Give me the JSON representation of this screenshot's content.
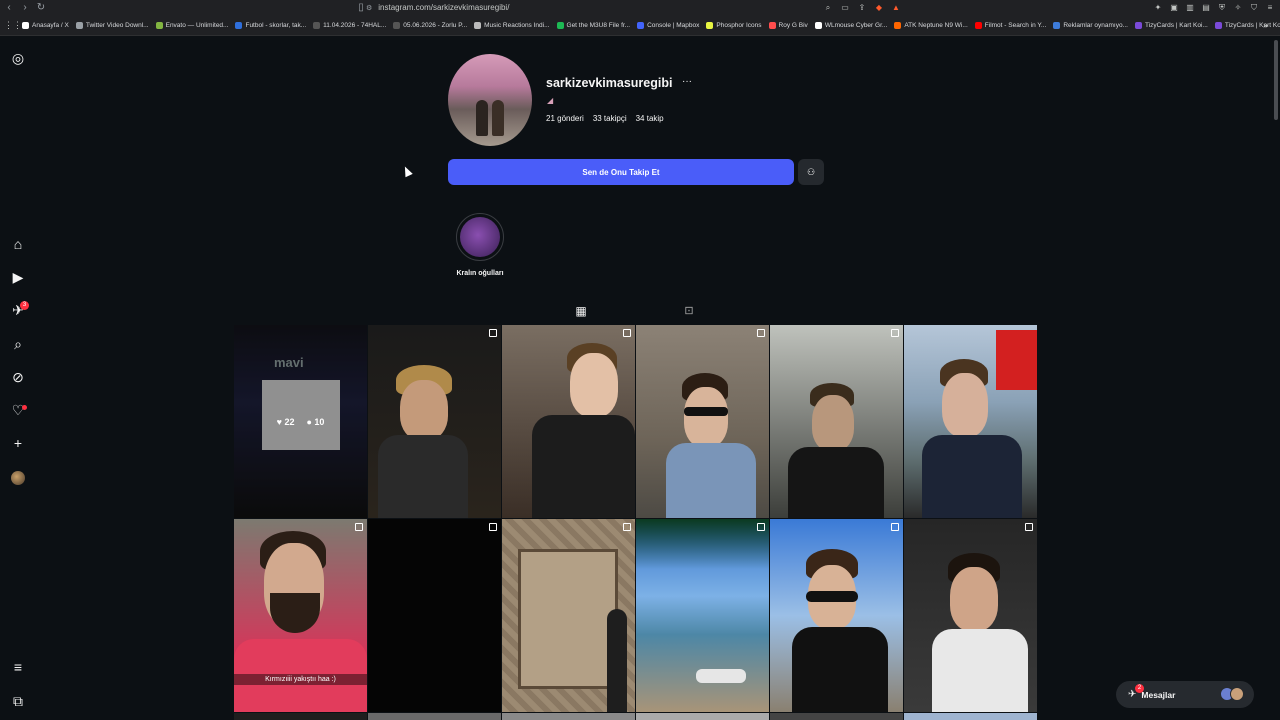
{
  "browser": {
    "url": "instagram.com/sarkizevkimasuregibi/",
    "bookmarks": [
      {
        "label": "Anasayfa / X",
        "color": "#ffffff"
      },
      {
        "label": "Twitter Video Downl...",
        "color": "#9aa0a6"
      },
      {
        "label": "Envato — Unlimited...",
        "color": "#82b541"
      },
      {
        "label": "Futbol - skorlar, tak...",
        "color": "#2f6fdc"
      },
      {
        "label": "11.04.2026 - 74HAL...",
        "color": "#555555"
      },
      {
        "label": "05.06.2026 - Zorlu P...",
        "color": "#555555"
      },
      {
        "label": "Music Reactions Indi...",
        "color": "#bbbbbb"
      },
      {
        "label": "Get the M3U8 File fr...",
        "color": "#1db954"
      },
      {
        "label": "Console | Mapbox",
        "color": "#4264fb"
      },
      {
        "label": "Phosphor Icons",
        "color": "#e8f542"
      },
      {
        "label": "Roy G Biv",
        "color": "#ff4d4d"
      },
      {
        "label": "WLmouse Cyber Gr...",
        "color": "#ffffff"
      },
      {
        "label": "ATK Neptune N9 Wi...",
        "color": "#ff6600"
      },
      {
        "label": "Filmot - Search in Y...",
        "color": "#ff0000"
      },
      {
        "label": "Reklamlar oynamıyo...",
        "color": "#3d7bd9"
      },
      {
        "label": "TizyCards | Kart Koi...",
        "color": "#7a4ad9"
      },
      {
        "label": "TizyCards | Kart Koi...",
        "color": "#7a4ad9"
      }
    ]
  },
  "sidebar": {
    "notifications_badge": "3"
  },
  "profile": {
    "username": "sarkizevkimasuregibi",
    "stats": {
      "posts": "21 gönderi",
      "followers": "33 takipçi",
      "following": "34 takip"
    },
    "follow_button": "Sen de Onu Takip Et",
    "highlight_label": "Kralın oğulları"
  },
  "posts": [
    {
      "likes": "22",
      "comments": "10"
    },
    {},
    {},
    {},
    {},
    {},
    {
      "caption": "Kırmızıiii yakıştıı haa :)"
    }
  ],
  "messages": {
    "label": "Mesajlar",
    "badge": "2"
  },
  "colors": {
    "accent": "#4a5df9",
    "background": "#0c1014",
    "badge": "#ff3040"
  }
}
